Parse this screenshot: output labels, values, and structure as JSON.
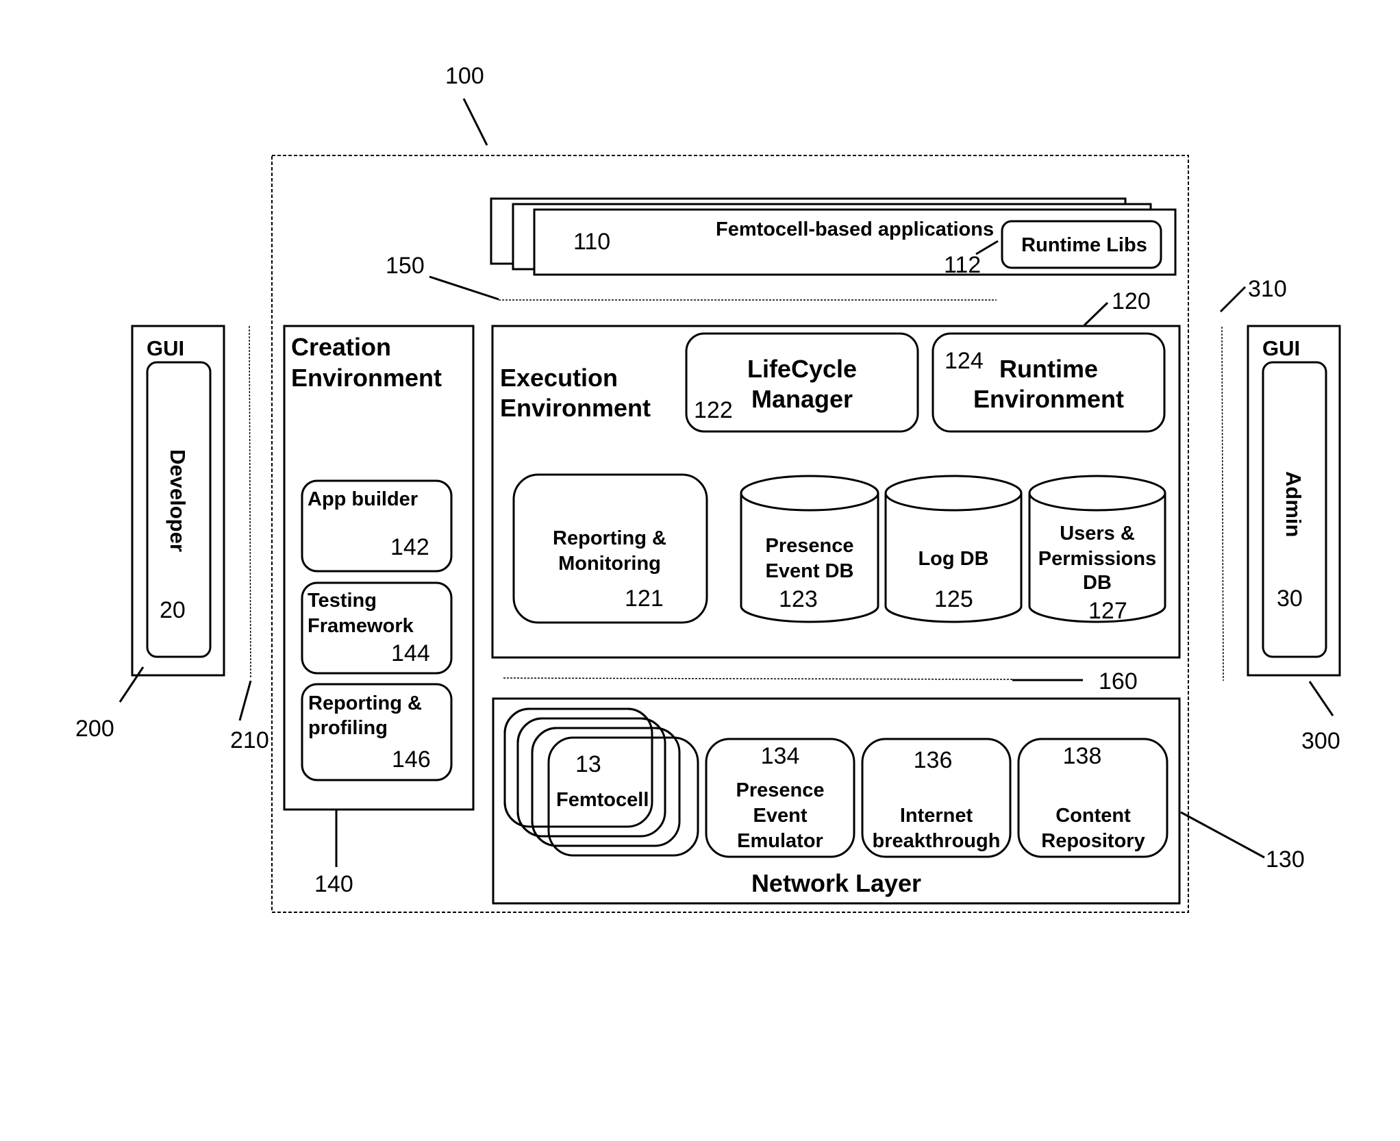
{
  "figure": {
    "system_ref": "100",
    "apps": {
      "title": "Femtocell-based applications",
      "ref": "110",
      "runtime_libs": "Runtime Libs",
      "runtime_libs_ref": "112"
    },
    "bus_top_ref": "150",
    "bus_bottom_ref": "160",
    "developer_gui": {
      "title": "GUI",
      "role": "Developer",
      "ref": "20",
      "box_ref": "200",
      "link_ref": "210"
    },
    "admin_gui": {
      "title": "GUI",
      "role": "Admin",
      "ref": "30",
      "box_ref": "300",
      "link_ref": "310"
    },
    "creation": {
      "title_line1": "Creation",
      "title_line2": "Environment",
      "ref": "140",
      "items": [
        {
          "line1": "App builder",
          "line2": "",
          "ref": "142"
        },
        {
          "line1": "Testing",
          "line2": "Framework",
          "ref": "144"
        },
        {
          "line1": "Reporting &",
          "line2": "profiling",
          "ref": "146"
        }
      ]
    },
    "execution": {
      "title_line1": "Execution",
      "title_line2": "Environment",
      "ref": "120",
      "lifecycle": {
        "line1": "LifeCycle",
        "line2": "Manager",
        "ref": "122"
      },
      "runtime": {
        "line1": "Runtime",
        "line2": "Environment",
        "ref": "124"
      },
      "reporting": {
        "line1": "Reporting &",
        "line2": "Monitoring",
        "ref": "121"
      },
      "databases": [
        {
          "line1": "Presence",
          "line2": "Event DB",
          "line3": "",
          "ref": "123"
        },
        {
          "line1": "Log DB",
          "line2": "",
          "line3": "",
          "ref": "125"
        },
        {
          "line1": "Users &",
          "line2": "Permissions",
          "line3": "DB",
          "ref": "127"
        }
      ]
    },
    "network": {
      "title": "Network Layer",
      "ref": "130",
      "femtocell": {
        "label": "Femtocell",
        "ref": "13"
      },
      "components": [
        {
          "line1": "Presence",
          "line2": "Event",
          "line3": "Emulator",
          "ref": "134"
        },
        {
          "line1": "",
          "line2": "Internet",
          "line3": "breakthrough",
          "ref": "136"
        },
        {
          "line1": "",
          "line2": "Content",
          "line3": "Repository",
          "ref": "138"
        }
      ]
    }
  }
}
